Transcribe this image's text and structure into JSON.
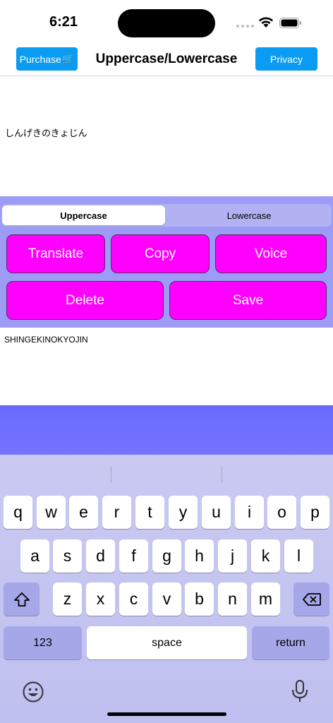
{
  "status_bar": {
    "time": "6:21"
  },
  "nav": {
    "purchase_label": "Purchase",
    "purchase_icon": "🛒",
    "title": "Uppercase/Lowercase",
    "privacy_label": "Privacy",
    "accent_color": "#0a9cf2"
  },
  "input": {
    "text": "しんげきのきょじん"
  },
  "segmented": {
    "options": [
      "Uppercase",
      "Lowercase"
    ],
    "selected": "Uppercase"
  },
  "actions": {
    "translate": "Translate",
    "copy": "Copy",
    "voice": "Voice",
    "delete": "Delete",
    "save": "Save",
    "button_color": "#ff00ff"
  },
  "output": {
    "text": "SHINGEKINOKYOJIN"
  },
  "keyboard": {
    "row1": [
      "q",
      "w",
      "e",
      "r",
      "t",
      "y",
      "u",
      "i",
      "o",
      "p"
    ],
    "row2": [
      "a",
      "s",
      "d",
      "f",
      "g",
      "h",
      "j",
      "k",
      "l"
    ],
    "row3": [
      "z",
      "x",
      "c",
      "v",
      "b",
      "n",
      "m"
    ],
    "numbers_label": "123",
    "space_label": "space",
    "return_label": "return"
  }
}
